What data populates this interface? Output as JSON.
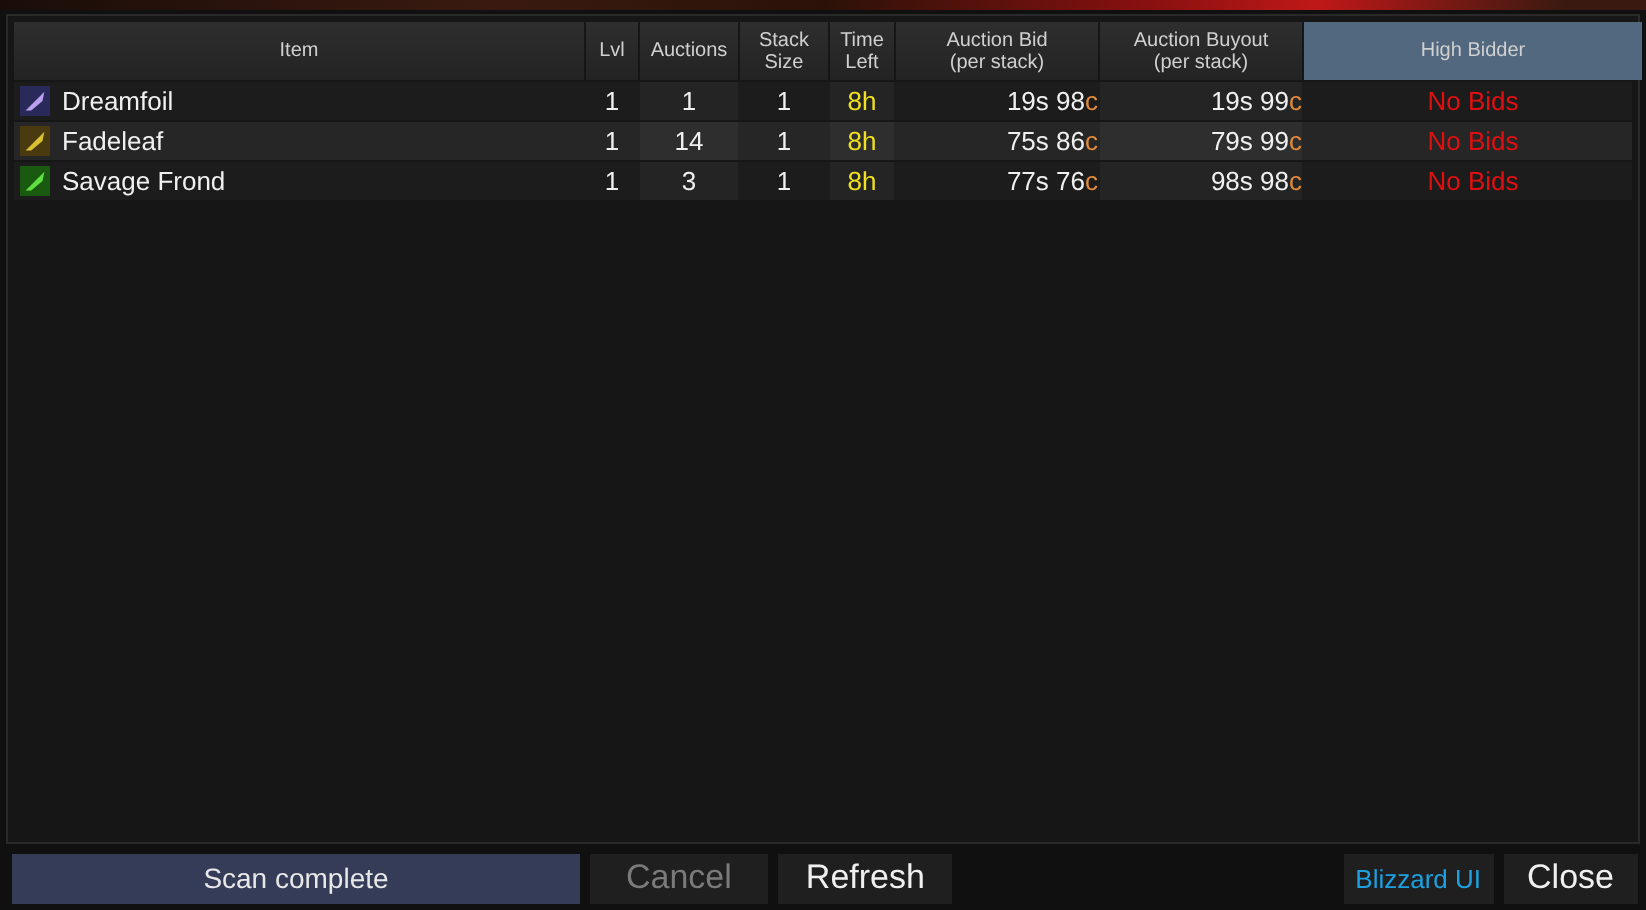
{
  "table": {
    "columns": [
      {
        "label": "Item",
        "selected": false
      },
      {
        "label": "Lvl",
        "selected": false
      },
      {
        "label": "Auctions",
        "selected": false
      },
      {
        "label": "Stack Size",
        "selected": false
      },
      {
        "label": "Time Left",
        "selected": false
      },
      {
        "label": "Auction Bid",
        "sub": "(per stack)",
        "selected": false
      },
      {
        "label": "Auction Buyout",
        "sub": "(per stack)",
        "selected": false
      },
      {
        "label": "High Bidder",
        "selected": true
      }
    ],
    "rows": [
      {
        "item": "Dreamfoil",
        "lvl": "1",
        "auctions": "1",
        "stack": "1",
        "time_left": "8h",
        "bid": "19s 98",
        "bid_unit": "c",
        "buyout": "19s 99",
        "buyout_unit": "c",
        "high_bidder": "No Bids"
      },
      {
        "item": "Fadeleaf",
        "lvl": "1",
        "auctions": "14",
        "stack": "1",
        "time_left": "8h",
        "bid": "75s 86",
        "bid_unit": "c",
        "buyout": "79s 99",
        "buyout_unit": "c",
        "high_bidder": "No Bids"
      },
      {
        "item": "Savage Frond",
        "lvl": "1",
        "auctions": "3",
        "stack": "1",
        "time_left": "8h",
        "bid": "77s 76",
        "bid_unit": "c",
        "buyout": "98s 98",
        "buyout_unit": "c",
        "high_bidder": "No Bids"
      }
    ]
  },
  "status": "Scan complete",
  "buttons": [
    {
      "label": "Cancel",
      "disabled": true
    },
    {
      "label": "Refresh",
      "disabled": false
    }
  ],
  "blizzard_ui": "Blizzard UI",
  "close": "Close"
}
